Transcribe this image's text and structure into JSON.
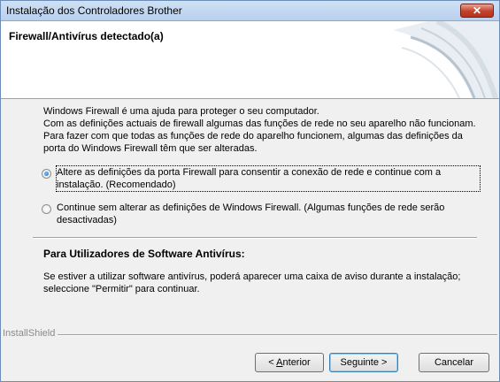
{
  "window": {
    "title": "Instalação dos Controladores Brother",
    "close_symbol": "✕"
  },
  "header": {
    "title": "Firewall/Antivírus detectado(a)"
  },
  "body": {
    "description": "Windows Firewall é uma ajuda para proteger o seu computador.\nCom as definições actuais de firewall  algumas das funções de rede no seu aparelho não funcionam. Para fazer com que todas as funções de rede do aparelho funcionem, algumas das definições da porta do Windows Firewall têm que ser alteradas.",
    "options": [
      {
        "label": "Altere as definições da porta Firewall para consentir a conexão de rede e continue com a instalação. (Recomendado)",
        "selected": true
      },
      {
        "label": "Continue sem alterar as definições de Windows Firewall. (Algumas funções de rede serão desactivadas)",
        "selected": false
      }
    ],
    "antivirus_title": "Para Utilizadores de Software Antivírus:",
    "antivirus_text": "Se estiver a utilizar software antivírus, poderá aparecer uma caixa de aviso durante a instalação; seleccione \"Permitir\" para continuar."
  },
  "footer": {
    "brand": "InstallShield",
    "back_prefix": "< ",
    "back_accel": "A",
    "back_rest": "nterior",
    "next_label": "Seguinte >",
    "cancel_label": "Cancelar"
  },
  "colors": {
    "titlebar": "#b9d1ee",
    "close_button": "#c4412c",
    "radio_selected": "#1f63b5"
  }
}
